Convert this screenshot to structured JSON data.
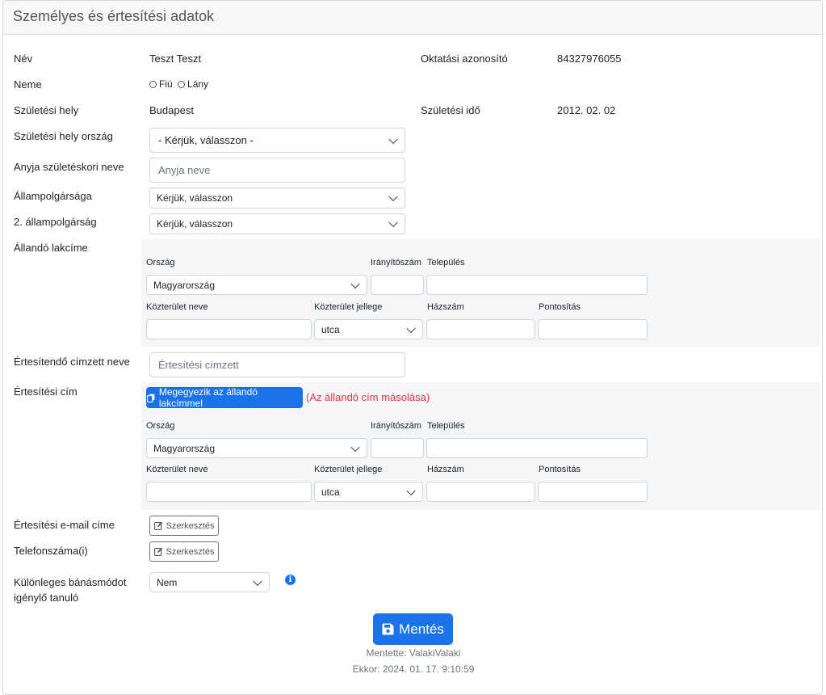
{
  "card": {
    "title": "Személyes és értesítési adatok"
  },
  "personal": {
    "name_label": "Név",
    "name_value": "Teszt Teszt",
    "edu_id_label": "Oktatási azonosító",
    "edu_id_value": "84327976055",
    "gender_label": "Neme",
    "gender_male": "Fiú",
    "gender_female": "Lány",
    "birthplace_label": "Születési hely",
    "birthplace_value": "Budapest",
    "birthdate_label": "Születési idő",
    "birthdate_value": "2012. 02. 02",
    "birth_country_label": "Születési hely ország",
    "birth_country_value": "- Kérjük, válasszon -",
    "mother_name_label": "Anyja születéskori neve",
    "mother_name_placeholder": "Anyja neve",
    "citizenship_label": "Állampolgársága",
    "citizenship_value": "Kérjük, válasszon",
    "citizenship2_label": "2. állampolgárság",
    "citizenship2_value": "Kérjük, válasszon"
  },
  "permanent_address": {
    "label": "Állandó lakcíme",
    "country_label": "Ország",
    "country_value": "Magyarország",
    "zip_label": "Irányítószám",
    "city_label": "Település",
    "street_label": "Közterület neve",
    "street_type_label": "Közterület jellege",
    "street_type_value": "utca",
    "house_label": "Házszám",
    "detail_label": "Pontosítás"
  },
  "notification": {
    "recipient_label": "Értesítendő címzett neve",
    "recipient_placeholder": "Értesítési címzett",
    "address_label": "Értesítési cím",
    "same_button": "Megegyezik az állandó lakcímmel",
    "copy_note": "(Az állandó cím másolása)",
    "country_label": "Ország",
    "country_value": "Magyarország",
    "zip_label": "Irányítószám",
    "city_label": "Település",
    "street_label": "Közterület neve",
    "street_type_label": "Közterület jellege",
    "street_type_value": "utca",
    "house_label": "Házszám",
    "detail_label": "Pontosítás",
    "email_label": "Értesítési e-mail címe",
    "phone_label": "Telefonszáma(i)",
    "edit_button": "Szerkesztés"
  },
  "special": {
    "label_line1": "Különleges bánásmódot",
    "label_line2": "igénylő tanuló",
    "value": "Nem",
    "info_glyph": "i"
  },
  "footer": {
    "save_button": "Mentés",
    "saved_by": "Mentette: ValakiValaki",
    "saved_at": "Ekkor: 2024. 01. 17. 9:10:59"
  },
  "colors": {
    "primary": "#1a73e8",
    "danger": "#dc3545",
    "panel": "#f4f6f8"
  }
}
